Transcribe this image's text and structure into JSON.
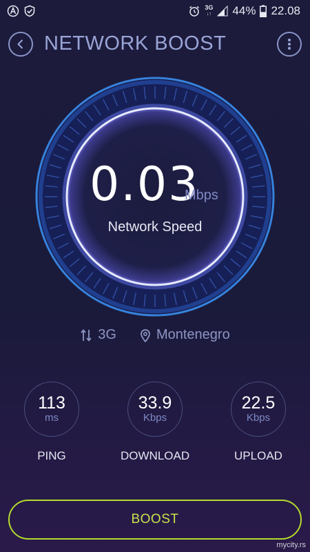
{
  "status_bar": {
    "left_icons": [
      "app-a-icon",
      "shield-check-icon"
    ],
    "alarm_icon": "alarm-icon",
    "network_type": "3G",
    "network_sub": "↓↑",
    "signal_icon": "signal-icon",
    "battery_percent": "44%",
    "battery_level": 0.44,
    "time": "22.08"
  },
  "header": {
    "title": "NETWORK BOOST",
    "back_icon": "chevron-left-icon",
    "menu_icon": "more-vertical-icon"
  },
  "speed": {
    "value": "0.03",
    "unit": "Mbps",
    "label": "Network Speed"
  },
  "info": {
    "network_icon": "transfer-arrows-icon",
    "network": "3G",
    "location_icon": "location-pin-icon",
    "location": "Montenegro"
  },
  "stats": [
    {
      "value": "113",
      "unit": "ms",
      "label": "PING"
    },
    {
      "value": "33.9",
      "unit": "Kbps",
      "label": "DOWNLOAD"
    },
    {
      "value": "22.5",
      "unit": "Kbps",
      "label": "UPLOAD"
    }
  ],
  "boost": {
    "label": "BOOST"
  },
  "watermark": "mycity.rs",
  "colors": {
    "background": "#1c1b3c",
    "accent": "#b4dc2c",
    "title": "#9aa5d6",
    "ring_glow": "#4aa8ff"
  }
}
